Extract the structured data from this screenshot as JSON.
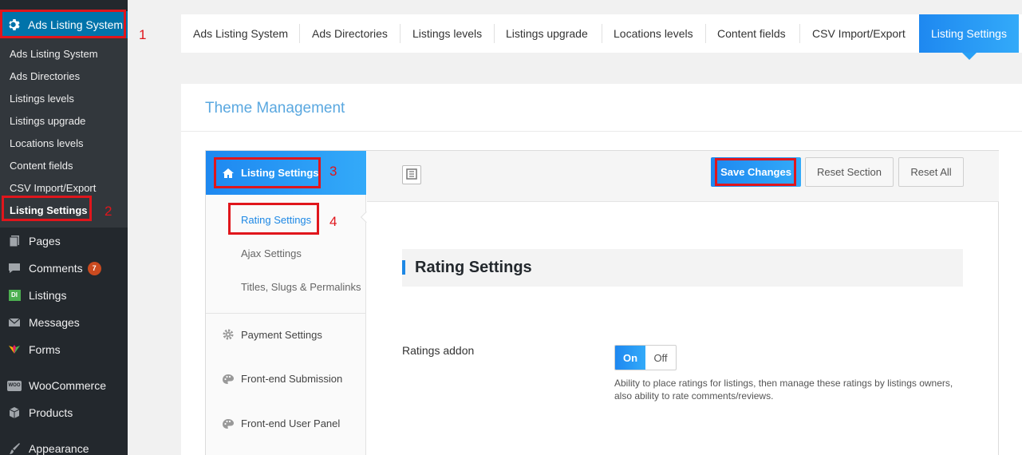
{
  "sidebar": {
    "top_item": "Ads Listing System",
    "submenu": [
      "Ads Listing System",
      "Ads Directories",
      "Listings levels",
      "Listings upgrade",
      "Locations levels",
      "Content fields",
      "CSV Import/Export",
      "Listing Settings"
    ],
    "menu": {
      "pages": "Pages",
      "comments": "Comments",
      "comments_count": "7",
      "listings": "Listings",
      "listings_icon_text": "DI",
      "messages": "Messages",
      "forms": "Forms",
      "woocommerce": "WooCommerce",
      "woo_icon_text": "WOO",
      "products": "Products",
      "appearance": "Appearance"
    }
  },
  "annotations": [
    "1",
    "2",
    "3",
    "4"
  ],
  "tabs": [
    "Ads Listing System",
    "Ads Directories",
    "Listings levels",
    "Listings upgrade",
    "Locations levels",
    "Content fields",
    "CSV Import/Export",
    "Listing Settings"
  ],
  "card": {
    "title": "Theme Management"
  },
  "leftnav": {
    "active": "Listing Settings",
    "subitems": [
      "Rating Settings",
      "Ajax Settings",
      "Titles, Slugs & Permalinks"
    ],
    "items": [
      "Payment Settings",
      "Front-end Submission",
      "Front-end User Panel"
    ]
  },
  "toolbar": {
    "save": "Save Changes",
    "reset_section": "Reset Section",
    "reset_all": "Reset All"
  },
  "section": {
    "title": "Rating Settings",
    "field_label": "Ratings addon",
    "toggle_on": "On",
    "toggle_off": "Off",
    "toggle_value": "On",
    "description": "Ability to place ratings for listings, then manage these ratings by listings owners, also ability to rate comments/reviews."
  },
  "colors": {
    "accent": "#1e88e5",
    "wp_sidebar": "#23282d",
    "annotation": "#e0161c"
  }
}
